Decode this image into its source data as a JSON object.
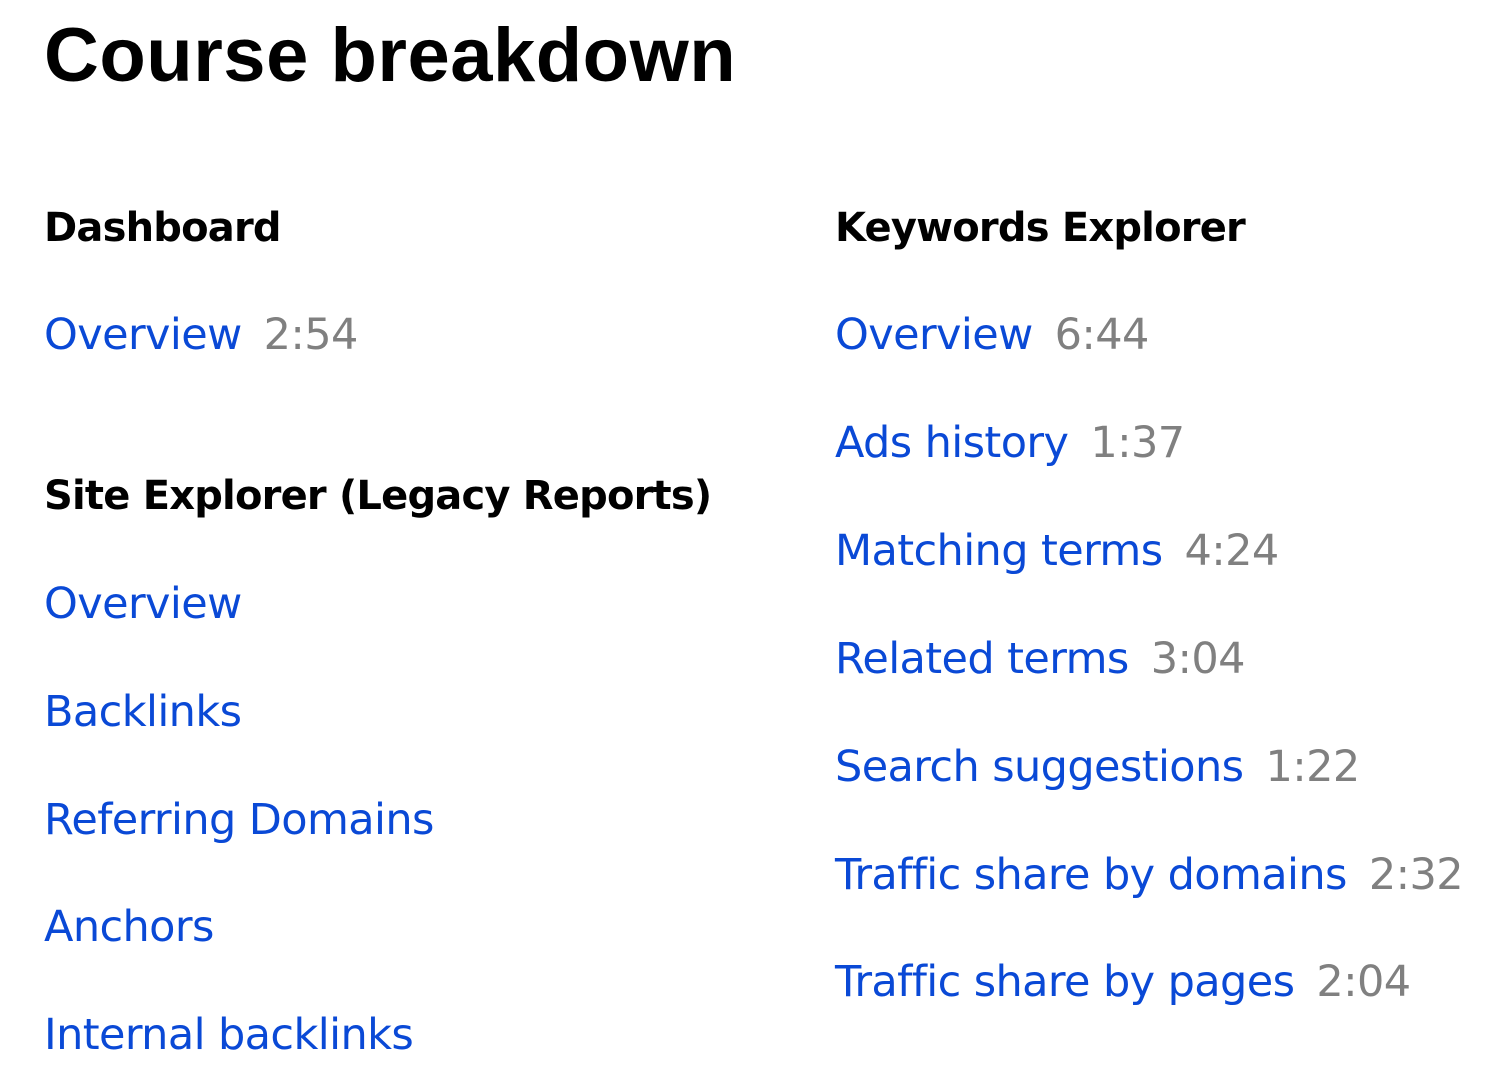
{
  "page": {
    "title": "Course breakdown"
  },
  "colors": {
    "link": "#0a49d6",
    "duration": "#808080",
    "heading": "#000000"
  },
  "sections": {
    "dashboard": {
      "heading": "Dashboard",
      "lessons": [
        {
          "title": "Overview",
          "duration": "2:54"
        }
      ]
    },
    "site_explorer": {
      "heading": "Site Explorer (Legacy Reports)",
      "lessons": [
        {
          "title": "Overview",
          "duration": ""
        },
        {
          "title": "Backlinks",
          "duration": ""
        },
        {
          "title": "Referring Domains",
          "duration": ""
        },
        {
          "title": "Anchors",
          "duration": ""
        },
        {
          "title": "Internal backlinks",
          "duration": ""
        }
      ]
    },
    "keywords_explorer": {
      "heading": "Keywords Explorer",
      "lessons": [
        {
          "title": "Overview",
          "duration": "6:44"
        },
        {
          "title": "Ads history",
          "duration": "1:37"
        },
        {
          "title": "Matching terms",
          "duration": "4:24"
        },
        {
          "title": "Related terms",
          "duration": "3:04"
        },
        {
          "title": "Search suggestions",
          "duration": "1:22"
        },
        {
          "title": "Traffic share by domains",
          "duration": "2:32"
        },
        {
          "title": "Traffic share by pages",
          "duration": "2:04"
        }
      ]
    }
  }
}
